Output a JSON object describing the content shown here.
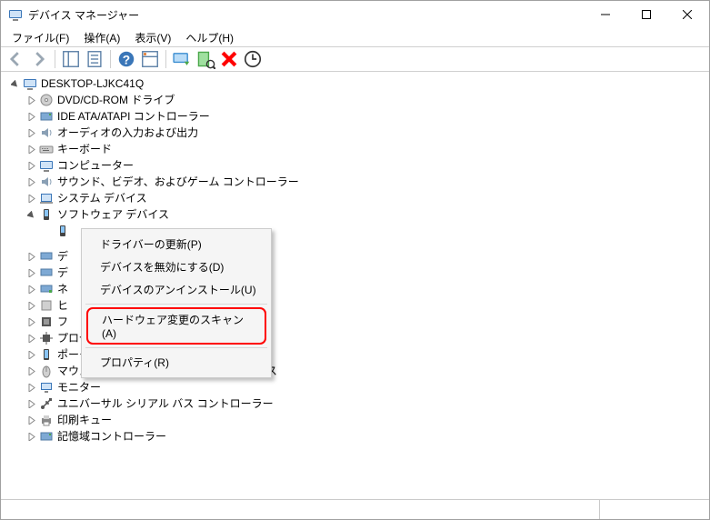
{
  "window": {
    "title": "デバイス マネージャー"
  },
  "menu": {
    "file": "ファイル(F)",
    "action": "操作(A)",
    "view": "表示(V)",
    "help": "ヘルプ(H)"
  },
  "toolbar": {
    "back": "back",
    "forward": "forward",
    "show_hide": "show-hide",
    "props_sheet": "properties-sheet",
    "help": "help",
    "action": "action-center",
    "monitor": "update-driver",
    "scan": "scan-hardware",
    "remove": "uninstall-device",
    "refresh": "refresh"
  },
  "tree": {
    "root": "DESKTOP-LJKC41Q",
    "items": [
      {
        "id": "dvd",
        "label": "DVD/CD-ROM ドライブ",
        "icon": "disc"
      },
      {
        "id": "ide",
        "label": "IDE ATA/ATAPI コントローラー",
        "icon": "storage-ctrl"
      },
      {
        "id": "audio-io",
        "label": "オーディオの入力および出力",
        "icon": "audio"
      },
      {
        "id": "keyboard",
        "label": "キーボード",
        "icon": "keyboard"
      },
      {
        "id": "computer",
        "label": "コンピューター",
        "icon": "computer"
      },
      {
        "id": "sound-game",
        "label": "サウンド、ビデオ、およびゲーム コントローラー",
        "icon": "audio"
      },
      {
        "id": "system",
        "label": "システム デバイス",
        "icon": "system"
      },
      {
        "id": "software",
        "label": "ソフトウェア デバイス",
        "icon": "software",
        "expanded": true
      },
      {
        "id": "software-child",
        "label": "",
        "icon": "software",
        "child_of": "software",
        "selected": true
      },
      {
        "id": "display",
        "label": "デ",
        "icon": "display",
        "truncated": true
      },
      {
        "id": "display2",
        "label": "デ",
        "icon": "display",
        "truncated": true
      },
      {
        "id": "network",
        "label": "ネ",
        "icon": "network",
        "truncated": true
      },
      {
        "id": "hid",
        "label": "ヒ",
        "icon": "hid",
        "truncated": true
      },
      {
        "id": "firmware",
        "label": "フ",
        "icon": "firmware",
        "truncated": true
      },
      {
        "id": "processor",
        "label": "プロセッサ",
        "icon": "cpu"
      },
      {
        "id": "portable",
        "label": "ポータブル デバイス",
        "icon": "portable"
      },
      {
        "id": "mouse",
        "label": "マウスとそのほかのポインティング デバイス",
        "icon": "mouse"
      },
      {
        "id": "monitor",
        "label": "モニター",
        "icon": "monitor"
      },
      {
        "id": "usb",
        "label": "ユニバーサル シリアル バス コントローラー",
        "icon": "usb"
      },
      {
        "id": "print-queue",
        "label": "印刷キュー",
        "icon": "printer"
      },
      {
        "id": "storage-ctrl",
        "label": "記憶域コントローラー",
        "icon": "storage-ctrl"
      }
    ]
  },
  "context": {
    "update": "ドライバーの更新(P)",
    "disable": "デバイスを無効にする(D)",
    "uninstall": "デバイスのアンインストール(U)",
    "scan": "ハードウェア変更のスキャン(A)",
    "props": "プロパティ(R)"
  }
}
